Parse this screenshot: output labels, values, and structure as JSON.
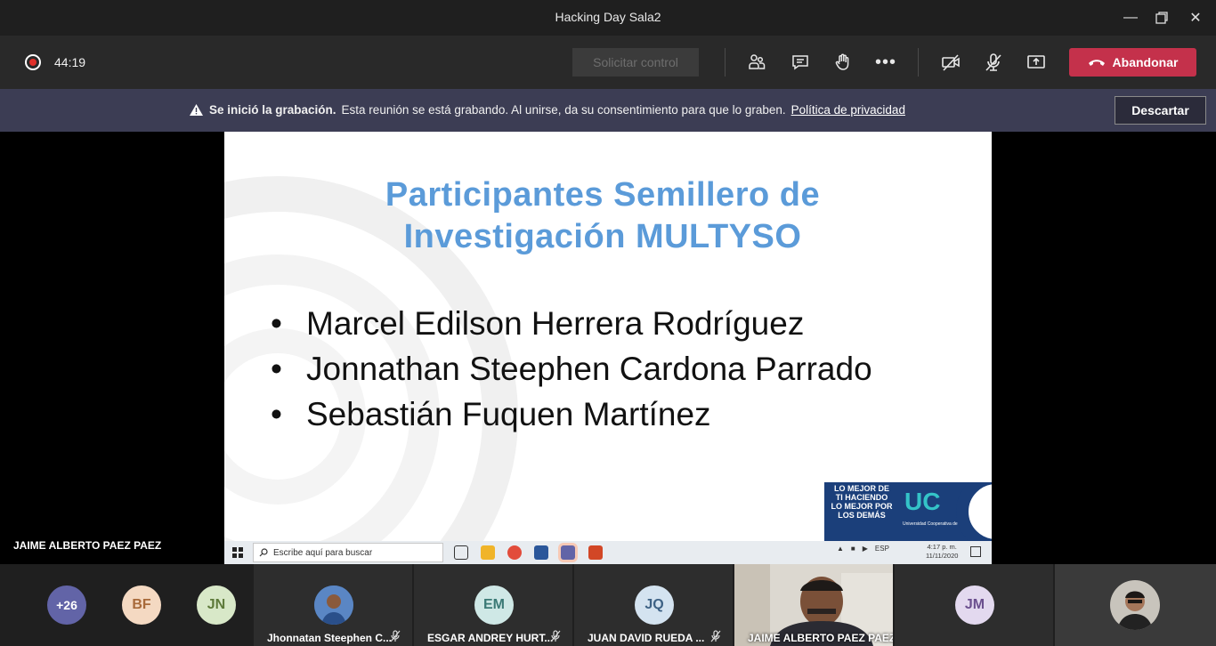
{
  "window": {
    "title": "Hacking Day Sala2"
  },
  "toolbar": {
    "timer": "44:19",
    "request_control_label": "Solicitar control",
    "leave_label": "Abandonar",
    "colors": {
      "leave": "#c4314b",
      "recording": "#e0302a"
    }
  },
  "banner": {
    "bold_text": "Se inició la grabación.",
    "text": "Esta reunión se está grabando. Al unirse, da su consentimiento para que lo graben.",
    "link_text": "Política de privacidad",
    "dismiss_label": "Descartar"
  },
  "slide": {
    "title_line1": "Participantes Semillero de",
    "title_line2": "Investigación MULTYSO",
    "bullets": [
      "Marcel Edilson Herrera Rodríguez",
      "Jonnathan Steephen Cardona Parrado",
      "Sebastián Fuquen Martínez"
    ],
    "logo_motto": "LO MEJOR DE TI HACIENDO LO MEJOR POR LOS DEMÁS",
    "logo_brand": "UC",
    "logo_name": "Universidad Cooperativa de Colombia"
  },
  "shared_taskbar": {
    "search_placeholder": "Escribe aquí para buscar",
    "language": "ESP",
    "time": "4:17 p. m.",
    "date": "11/11/2020"
  },
  "active_speaker": "JAIME ALBERTO PAEZ PAEZ",
  "participants": {
    "overflow": "+26",
    "avatars": [
      {
        "initials": "BF",
        "color": "#f4d9c2",
        "text_color": "#a86a3a"
      },
      {
        "initials": "JN",
        "color": "#d8e8c8",
        "text_color": "#5e7a3a"
      }
    ],
    "tiles": [
      {
        "name": "Jhonnatan Steephen C...",
        "muted": true
      },
      {
        "name": "ESGAR ANDREY HURT...",
        "initials": "EM",
        "muted": true
      },
      {
        "name": "JUAN DAVID RUEDA ...",
        "initials": "JQ",
        "muted": true
      },
      {
        "name": "JAIME ALBERTO PAEZ PAEZ",
        "muted": false
      },
      {
        "initials": "JM"
      }
    ]
  }
}
